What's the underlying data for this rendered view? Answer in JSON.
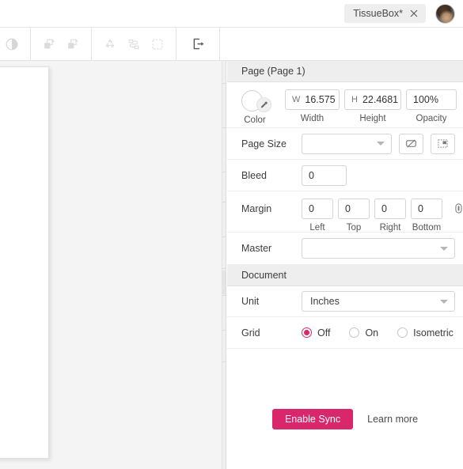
{
  "tabbar": {
    "document_tab": {
      "label": "TissueBox*",
      "close_icon": "close-icon"
    },
    "avatar": "user-avatar"
  },
  "toolbar": {
    "groups": [
      {
        "buttons": [
          {
            "icon": "contrast-icon",
            "label": "Contrast",
            "disabled": true
          }
        ]
      },
      {
        "buttons": [
          {
            "icon": "bring-forward-icon",
            "label": "Bring Forward",
            "disabled": true
          },
          {
            "icon": "send-backward-icon",
            "label": "Send Backward",
            "disabled": true
          }
        ]
      },
      {
        "buttons": [
          {
            "icon": "recycle-icon",
            "label": "Recycle",
            "disabled": true
          },
          {
            "icon": "connector-icon",
            "label": "Connector",
            "disabled": true
          },
          {
            "icon": "marquee-select-icon",
            "label": "Marquee Select",
            "disabled": true
          }
        ]
      },
      {
        "buttons": [
          {
            "icon": "export-icon",
            "label": "Export",
            "disabled": false
          }
        ]
      }
    ]
  },
  "canvas": {
    "page_sheet": "page-sheet",
    "dieline": "tissue-box-dieline"
  },
  "panel": {
    "page_section": {
      "title": "Page (Page 1)",
      "color": {
        "label": "Color",
        "icon": "eyedropper-icon",
        "value": ""
      },
      "width": {
        "prefix": "W",
        "value": "16.575",
        "caption": "Width"
      },
      "height": {
        "prefix": "H",
        "value": "22.4681",
        "caption": "Height"
      },
      "opacity": {
        "value": "100%",
        "caption": "Opacity"
      },
      "page_size": {
        "label": "Page Size",
        "selected": "",
        "rotate_icon": "rotate-orientation-icon",
        "fit_icon": "fit-to-drawing-icon"
      },
      "bleed": {
        "label": "Bleed",
        "value": "0"
      },
      "margin": {
        "label": "Margin",
        "fields": [
          {
            "value": "0",
            "caption": "Left"
          },
          {
            "value": "0",
            "caption": "Top"
          },
          {
            "value": "0",
            "caption": "Right"
          },
          {
            "value": "0",
            "caption": "Bottom"
          }
        ],
        "link_icon": "link-margins-icon"
      },
      "master": {
        "label": "Master",
        "selected": ""
      }
    },
    "document_section": {
      "title": "Document",
      "unit": {
        "label": "Unit",
        "selected": "Inches"
      },
      "grid": {
        "label": "Grid",
        "options": [
          {
            "label": "Off",
            "selected": true
          },
          {
            "label": "On",
            "selected": false
          },
          {
            "label": "Isometric",
            "selected": false
          }
        ]
      }
    },
    "sync": {
      "button_label": "Enable Sync",
      "link_label": "Learn more"
    }
  },
  "colors": {
    "accent": "#d8276a",
    "panel_header_bg": "#eeeeee",
    "canvas_bg": "#f4f4f4",
    "border": "#e0e0e0"
  }
}
